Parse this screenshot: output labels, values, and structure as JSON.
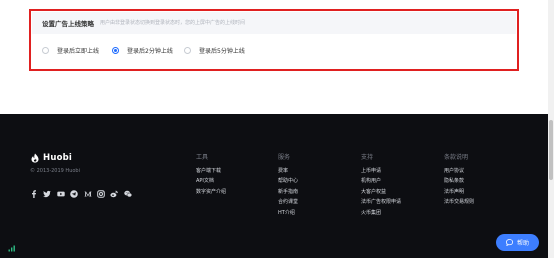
{
  "settings": {
    "title": "设置广告上线策略",
    "description": "用户由非登录状态切换到登录状态时，您的上屏中广告的上线时间",
    "options": [
      {
        "label": "登录后立即上线",
        "checked": false
      },
      {
        "label": "登录后2分钟上线",
        "checked": true
      },
      {
        "label": "登录后5分钟上线",
        "checked": false
      }
    ],
    "highlight_color": "#e02020",
    "accent_color": "#1f6cff"
  },
  "footer": {
    "brand": "Huobi",
    "copyright": "© 2013-2019 Huobi",
    "social_icons": [
      "facebook-icon",
      "twitter-icon",
      "youtube-icon",
      "telegram-icon",
      "medium-icon",
      "instagram-icon",
      "weibo-icon",
      "wechat-icon"
    ],
    "columns": [
      {
        "title": "工具",
        "links": [
          "客户端下载",
          "API文档",
          "数字资产介绍"
        ]
      },
      {
        "title": "服务",
        "links": [
          "费率",
          "帮助中心",
          "新手指南",
          "合约课堂",
          "HT介绍"
        ]
      },
      {
        "title": "支持",
        "links": [
          "上币申请",
          "机构用户",
          "大客户权益",
          "法币广告权限申请",
          "火币集团"
        ]
      },
      {
        "title": "条款说明",
        "links": [
          "用户协议",
          "隐私条款",
          "法币声明",
          "法币交易规则"
        ]
      }
    ],
    "background": "#0d0e12"
  },
  "help_button": {
    "label": "帮助",
    "color": "#3d7eff"
  }
}
